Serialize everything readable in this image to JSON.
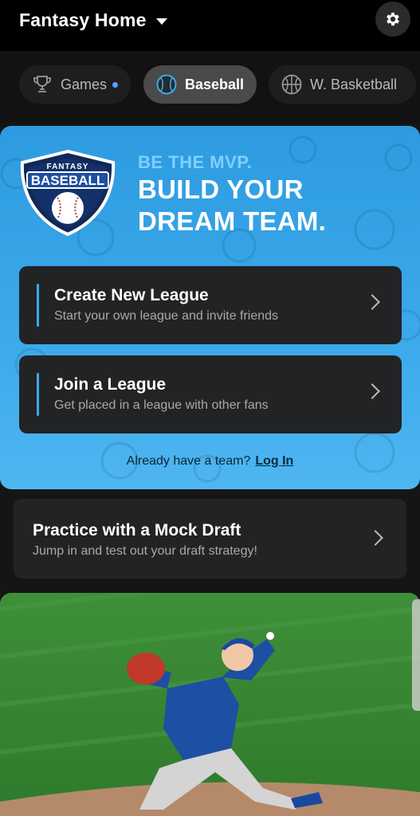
{
  "header": {
    "title": "Fantasy Home"
  },
  "tabs": [
    {
      "label": "Games",
      "icon": "trophy-icon",
      "active": false,
      "has_dot": true
    },
    {
      "label": "Baseball",
      "icon": "baseball-icon",
      "active": true
    },
    {
      "label": "W. Basketball",
      "icon": "basketball-icon",
      "active": false
    }
  ],
  "hero": {
    "badge_text_top": "FANTASY",
    "badge_text_main": "BASEBALL",
    "tagline": "BE THE MVP.",
    "headline": "BUILD YOUR DREAM TEAM."
  },
  "actions": [
    {
      "title": "Create New League",
      "subtitle": "Start your own league and invite friends"
    },
    {
      "title": "Join a League",
      "subtitle": "Get placed in a league with other fans"
    }
  ],
  "login": {
    "prompt": "Already have a team?",
    "link_label": "Log In"
  },
  "practice": {
    "title": "Practice with a Mock Draft",
    "subtitle": "Jump in and test out your draft strategy!"
  },
  "colors": {
    "accent_blue": "#3aa8ea",
    "card_dark": "#222325",
    "background": "#151515"
  }
}
